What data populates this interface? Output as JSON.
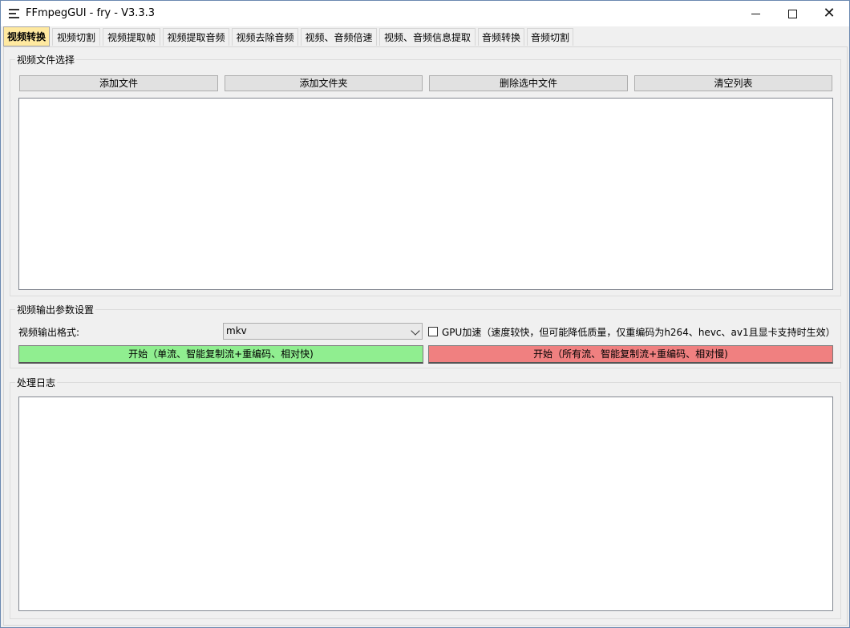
{
  "window": {
    "title": "FFmpegGUI - fry - V3.3.3"
  },
  "tabs": [
    {
      "label": "视频转换",
      "active": true
    },
    {
      "label": "视频切割"
    },
    {
      "label": "视频提取帧"
    },
    {
      "label": "视频提取音频"
    },
    {
      "label": "视频去除音频"
    },
    {
      "label": "视频、音频倍速"
    },
    {
      "label": "视频、音频信息提取"
    },
    {
      "label": "音频转换"
    },
    {
      "label": "音频切割"
    }
  ],
  "file_select": {
    "title": "视频文件选择",
    "add_file": "添加文件",
    "add_folder": "添加文件夹",
    "delete_selected": "删除选中文件",
    "clear_list": "清空列表"
  },
  "output_settings": {
    "title": "视频输出参数设置",
    "format_label": "视频输出格式:",
    "format_value": "mkv",
    "gpu_label": "GPU加速（速度较快，但可能降低质量，仅重编码为h264、hevc、av1且显卡支持时生效）",
    "gpu_checked": false,
    "start_single": "开始（单流、智能复制流+重编码、相对快)",
    "start_all": "开始（所有流、智能复制流+重编码、相对慢)"
  },
  "log": {
    "title": "处理日志"
  },
  "colors": {
    "active_tab": "#ffe9a0",
    "start_single_bg": "#90ee90",
    "start_all_bg": "#f08080"
  }
}
